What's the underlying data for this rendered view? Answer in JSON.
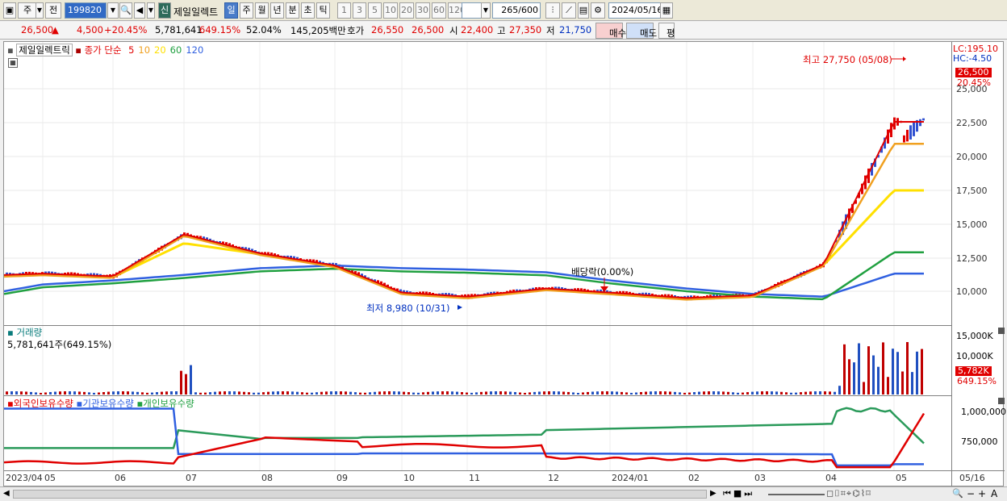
{
  "toolbar": {
    "mode": "주",
    "prev": "전",
    "code": "199820",
    "new_badge": "신",
    "name": "제일일렉트",
    "periods": [
      "일",
      "주",
      "월",
      "년",
      "분",
      "초",
      "틱"
    ],
    "nums": [
      "1",
      "3",
      "5",
      "10",
      "20",
      "30",
      "60",
      "120"
    ],
    "count": "265",
    "count_total": "/600",
    "date": "2024/05/16"
  },
  "quote": {
    "price": "26,500",
    "change": "4,500",
    "change_pct": "+20.45%",
    "volume": "5,781,641",
    "volume_pct": "649.15%",
    "ratio": "52.04%",
    "amount": "145,205백만",
    "hoga_label": "호가",
    "ask": "26,550",
    "bid": "26,500",
    "open_label": "시",
    "open": "22,400",
    "high_label": "고",
    "high": "27,350",
    "low_label": "저",
    "low": "21,750",
    "buy": "매수",
    "sell": "매도",
    "avg": "평"
  },
  "legend": {
    "name": "제일일렉트릭",
    "ma_label": "종가 단순",
    "ma": [
      {
        "label": "5",
        "color": "#e00000"
      },
      {
        "label": "10",
        "color": "#f0a020"
      },
      {
        "label": "20",
        "color": "#ffe000"
      },
      {
        "label": "60",
        "color": "#20a040"
      },
      {
        "label": "120",
        "color": "#3060e0"
      }
    ]
  },
  "annotations": {
    "high": "최고 27,750 (05/08)",
    "low": "최저 8,980 (10/31)",
    "dividend": "배당락(0.00%)",
    "lc": "LC:195.10",
    "hc": "HC:-4.50",
    "price_box": "26,500",
    "price_pct": "20.45%",
    "vol_box": "5,782K",
    "vol_pct": "649.15%"
  },
  "price_axis": [
    "25,000",
    "22,500",
    "20,000",
    "17,500",
    "15,000",
    "12,500",
    "10,000"
  ],
  "volume_panel": {
    "title": "거래량",
    "value": "5,781,641주(649.15%)",
    "axis": [
      "15,000K",
      "10,000K"
    ]
  },
  "holdings_panel": {
    "foreign": "외국인보유수량",
    "inst": "기관보유수량",
    "indiv": "개인보유수량",
    "axis": [
      "1,000,000",
      "750,000"
    ]
  },
  "x_axis": [
    "2023/04",
    "05",
    "06",
    "07",
    "08",
    "09",
    "10",
    "11",
    "12",
    "2024/01",
    "02",
    "03",
    "04",
    "05",
    "05/16"
  ],
  "chart_data": {
    "type": "line",
    "x": [
      "2023/04",
      "05",
      "06",
      "07",
      "08",
      "09",
      "10",
      "11",
      "12",
      "2024/01",
      "02",
      "03",
      "04",
      "05"
    ],
    "series": [
      {
        "name": "5",
        "values": [
          11200,
          11300,
          11100,
          14200,
          12800,
          11900,
          9900,
          9600,
          10200,
          9900,
          9500,
          9700,
          12000,
          22500
        ]
      },
      {
        "name": "120",
        "values": [
          10000,
          10500,
          10800,
          11200,
          11700,
          11900,
          11700,
          11600,
          11400,
          10800,
          10200,
          9800,
          9600,
          11300
        ]
      }
    ],
    "ylim": [
      9000,
      28000
    ]
  }
}
